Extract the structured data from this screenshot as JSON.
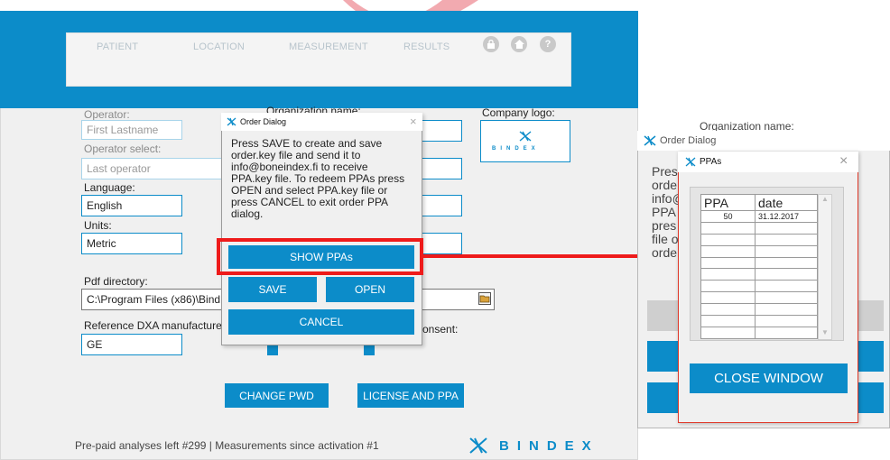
{
  "nav": {
    "items": [
      "PATIENT",
      "LOCATION",
      "MEASUREMENT",
      "RESULTS"
    ],
    "icons": [
      "lock-icon",
      "home-icon",
      "help-icon"
    ],
    "help_glyph": "?"
  },
  "settings": {
    "operator_label": "Operator:",
    "operator_value": "First Lastname",
    "operator_select_label": "Operator select:",
    "operator_select_value": "Last operator",
    "language_label": "Language:",
    "language_value": "English",
    "units_label": "Units:",
    "units_value": "Metric",
    "organization_label": "Organization name:",
    "company_logo_label": "Company logo:",
    "pdf_directory_label": "Pdf directory:",
    "pdf_directory_value": "C:\\Program Files (x86)\\Bind",
    "reference_label": "Reference DXA manufacturer",
    "reference_value": "GE",
    "consent_label": "onsent:",
    "change_pwd_label": "CHANGE PWD",
    "license_label": "LICENSE AND PPA"
  },
  "order_dialog": {
    "title": "Order Dialog",
    "close": "×",
    "instructions": "Press SAVE to create and save order.key file and send it to info@boneindex.fi to receive PPA.key file. To redeem PPAs press OPEN and select PPA.key file or press CANCEL to exit order PPA dialog.",
    "show_ppas_label": "SHOW PPAs",
    "save_label": "SAVE",
    "open_label": "OPEN",
    "cancel_label": "CANCEL"
  },
  "right_dialog": {
    "title": "Order Dialog",
    "behind_title_fragment": "Organization name:",
    "text_lines": [
      "Pres",
      "orde",
      "info@",
      "PPA",
      "pres",
      "file o",
      "orde"
    ]
  },
  "ppa_window": {
    "title": "PPAs",
    "close": "×",
    "columns": [
      "PPA",
      "date"
    ],
    "rows": [
      {
        "ppa": "50",
        "date": "31.12.2017"
      }
    ],
    "empty_rows": 10,
    "close_window_label": "CLOSE WINDOW"
  },
  "footer": {
    "status_text": "Pre-paid analyses left #299 | Measurements since activation #1",
    "brand": "BINDEX"
  },
  "colors": {
    "accent": "#0c8cc9",
    "highlight": "#ee1b1b",
    "background": "#f0f0f0"
  }
}
